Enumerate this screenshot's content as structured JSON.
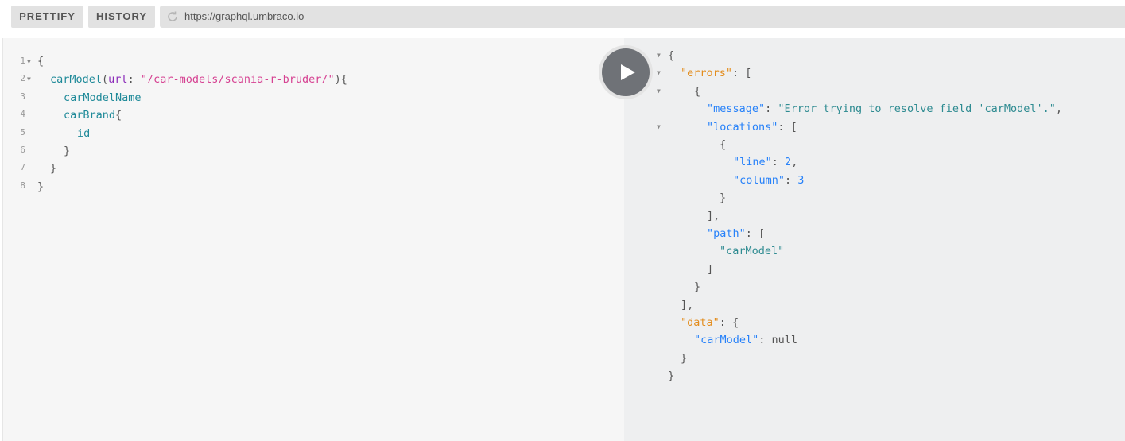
{
  "toolbar": {
    "prettify_label": "PRETTIFY",
    "history_label": "HISTORY",
    "url": "https://graphql.umbraco.io"
  },
  "query_editor": {
    "line_numbers": [
      "1",
      "2",
      "3",
      "4",
      "5",
      "6",
      "7",
      "8"
    ],
    "lines": {
      "l1": "{",
      "l2_field": "carModel",
      "l2_open": "(",
      "l2_arg": "url",
      "l2_colon": ": ",
      "l2_value": "\"/car-models/scania-r-bruder/\"",
      "l2_close": "){",
      "l3": "carModelName",
      "l4_field": "carBrand",
      "l4_brace": "{",
      "l5": "id",
      "l6": "}",
      "l7": "}",
      "l8": "}"
    }
  },
  "run_button": {
    "icon": "play-icon"
  },
  "result": {
    "r1": "{",
    "r2_key": "\"errors\"",
    "r2_rest": ": [",
    "r3": "{",
    "r4_key": "\"message\"",
    "r4_sep": ": ",
    "r4_val": "\"Error trying to resolve field 'carModel'.\"",
    "r4_comma": ",",
    "r5_key": "\"locations\"",
    "r5_rest": ": [",
    "r6": "{",
    "r7_key": "\"line\"",
    "r7_sep": ": ",
    "r7_val": "2",
    "r7_comma": ",",
    "r8_key": "\"column\"",
    "r8_sep": ": ",
    "r8_val": "3",
    "r9": "}",
    "r10": "],",
    "r11_key": "\"path\"",
    "r11_rest": ": [",
    "r12": "\"carModel\"",
    "r13": "]",
    "r14": "}",
    "r15": "],",
    "r16_key": "\"data\"",
    "r16_rest": ": {",
    "r17_key": "\"carModel\"",
    "r17_sep": ": ",
    "r17_val": "null",
    "r18": "}",
    "r19": "}"
  }
}
